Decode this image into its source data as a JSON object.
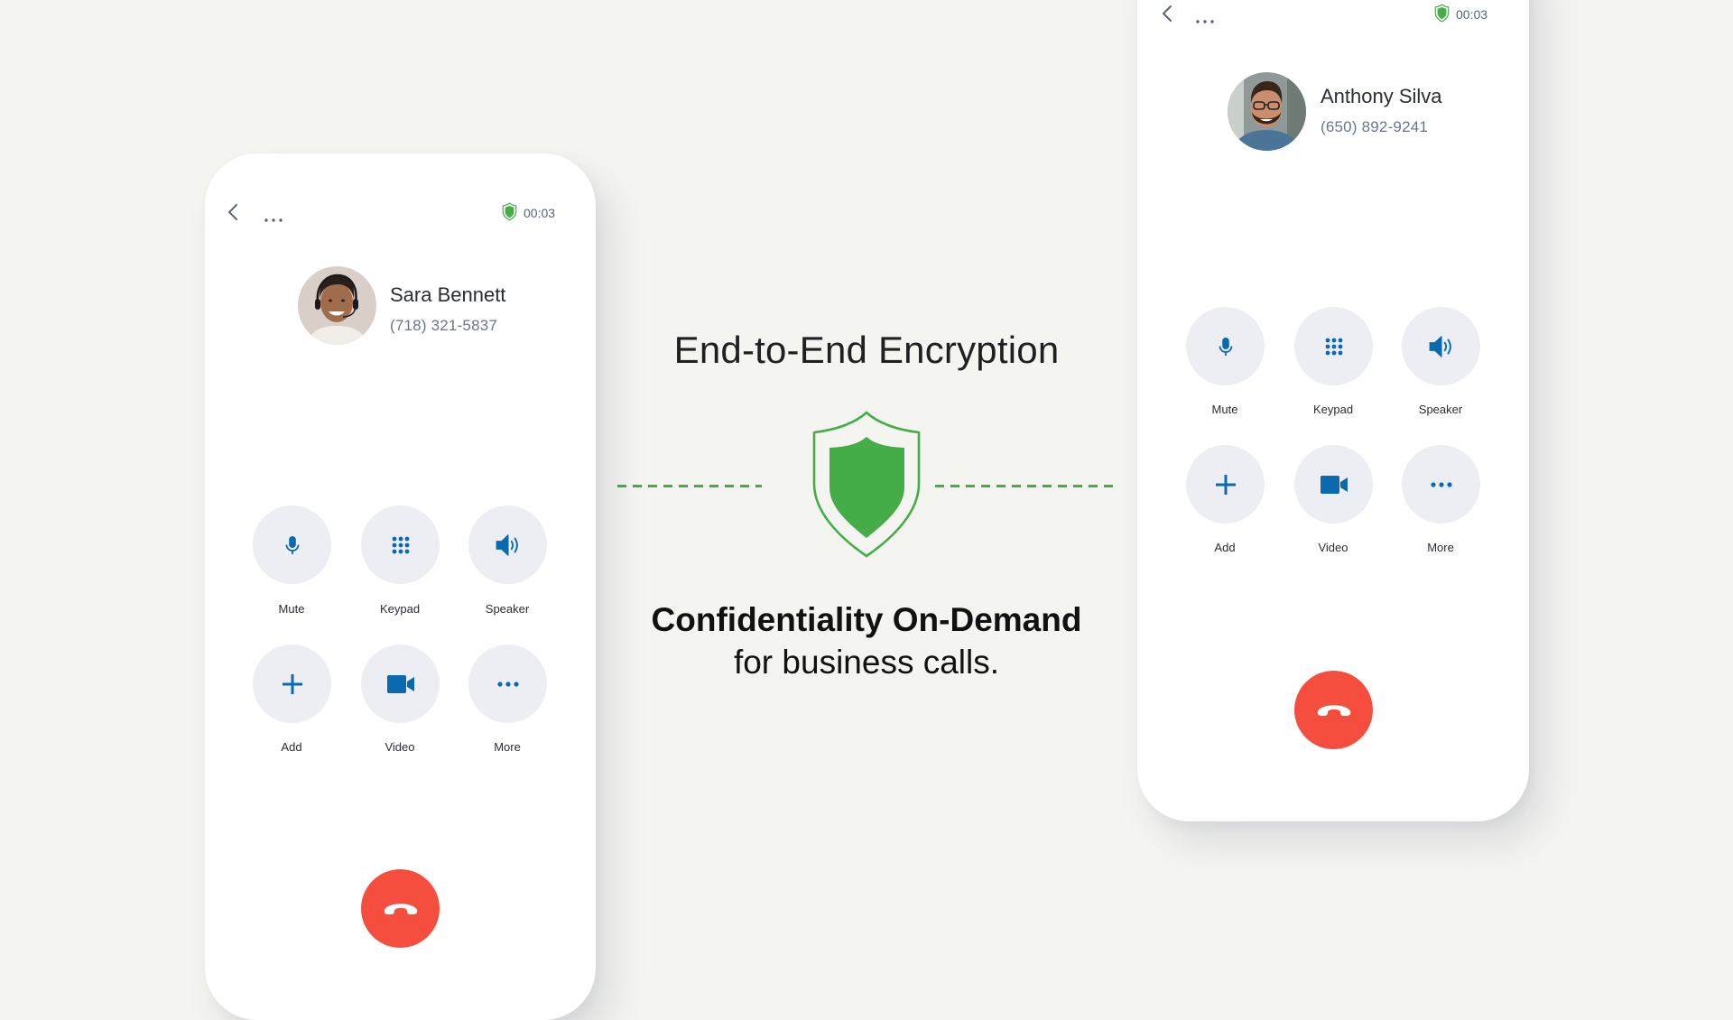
{
  "colors": {
    "background": "#f4f4f1",
    "accent_green": "#44ad47",
    "icon_blue": "#0b6aaf",
    "button_bg": "#eceef4",
    "end_call_red": "#f54e3f"
  },
  "center": {
    "headline": "End-to-End Encryption",
    "tagline_line1": "Confidentiality On-Demand",
    "tagline_line2": "for business calls.",
    "icon": "shield-icon"
  },
  "phones": [
    {
      "timer": "00:03",
      "contact": {
        "name": "Sara Bennett",
        "phone": "(718) 321-5837"
      },
      "controls": [
        {
          "label": "Mute",
          "icon": "microphone-icon"
        },
        {
          "label": "Keypad",
          "icon": "keypad-icon"
        },
        {
          "label": "Speaker",
          "icon": "speaker-icon"
        },
        {
          "label": "Add",
          "icon": "plus-icon"
        },
        {
          "label": "Video",
          "icon": "video-camera-icon"
        },
        {
          "label": "More",
          "icon": "more-dots-icon"
        }
      ],
      "end_call_icon": "hang-up-icon"
    },
    {
      "timer": "00:03",
      "contact": {
        "name": "Anthony Silva",
        "phone": "(650) 892-9241"
      },
      "controls": [
        {
          "label": "Mute",
          "icon": "microphone-icon"
        },
        {
          "label": "Keypad",
          "icon": "keypad-icon"
        },
        {
          "label": "Speaker",
          "icon": "speaker-icon"
        },
        {
          "label": "Add",
          "icon": "plus-icon"
        },
        {
          "label": "Video",
          "icon": "video-camera-icon"
        },
        {
          "label": "More",
          "icon": "more-dots-icon"
        }
      ],
      "end_call_icon": "hang-up-icon"
    }
  ]
}
